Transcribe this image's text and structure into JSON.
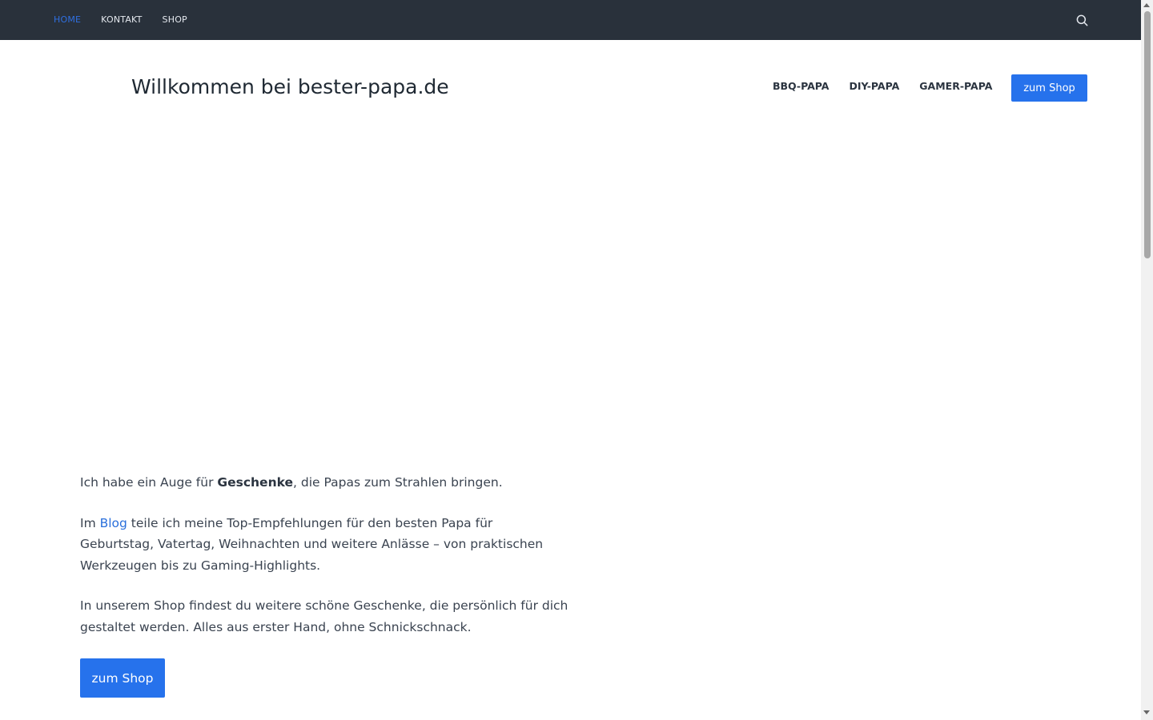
{
  "topbar": {
    "nav": [
      {
        "label": "HOME",
        "active": true
      },
      {
        "label": "KONTAKT",
        "active": false
      },
      {
        "label": "SHOP",
        "active": false
      }
    ],
    "search_icon": "search-icon"
  },
  "header": {
    "site_title": "Willkommen bei bester-papa.de",
    "nav": [
      {
        "label": "BBQ-PAPA"
      },
      {
        "label": "DIY-PAPA"
      },
      {
        "label": "GAMER-PAPA"
      }
    ],
    "cta_label": "zum Shop"
  },
  "content": {
    "p1_before": "Ich habe ein Auge für ",
    "p1_bold": "Geschenke",
    "p1_after": ", die Papas zum Strahlen bringen.",
    "p2_before": "Im ",
    "p2_link": "Blog",
    "p2_after": " teile ich meine Top-Empfehlungen für den besten Papa für Geburtstag, Vatertag, Weihnachten und weitere Anlässe – von praktischen Werkzeugen bis zu Gaming-Highlights.",
    "p3": "In unserem Shop findest du weitere schöne Geschenke, die persönlich für dich gestaltet werden. Alles aus erster Hand, ohne Schnickschnack.",
    "cta_label": "zum Shop"
  },
  "colors": {
    "topbar_bg": "#29313b",
    "accent": "#2672ec",
    "active_nav": "#2f6fe0"
  }
}
